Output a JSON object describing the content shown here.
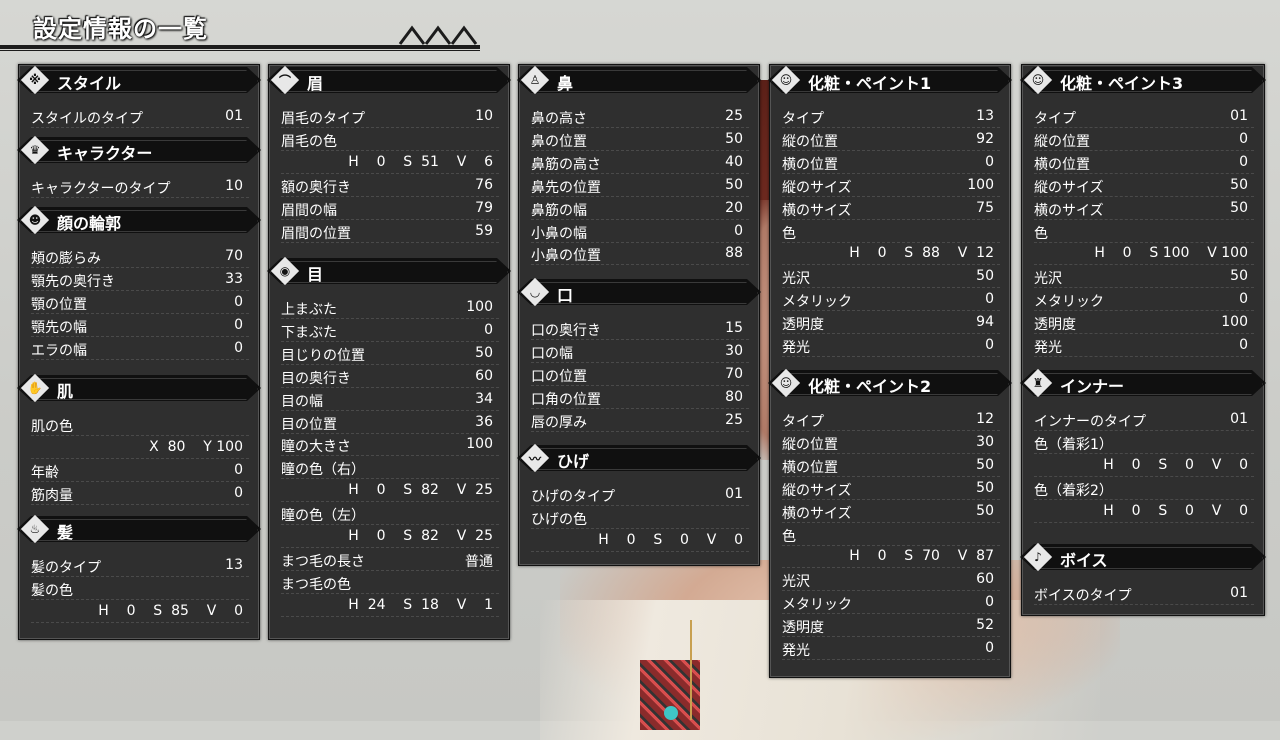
{
  "title": "設定情報の一覧",
  "columns": [
    {
      "sections": [
        {
          "head": "スタイル",
          "icon": "※",
          "rows": [
            {
              "k": "スタイルのタイプ",
              "v": "01"
            }
          ]
        },
        {
          "head": "キャラクター",
          "icon": "♛",
          "rows": [
            {
              "k": "キャラクターのタイプ",
              "v": "10"
            }
          ]
        },
        {
          "head": "顔の輪郭",
          "icon": "☻",
          "rows": [
            {
              "k": "頬の膨らみ",
              "v": "70"
            },
            {
              "k": "顎先の奥行き",
              "v": "33"
            },
            {
              "k": "顎の位置",
              "v": "0"
            },
            {
              "k": "顎先の幅",
              "v": "0"
            },
            {
              "k": "エラの幅",
              "v": "0"
            }
          ]
        },
        {
          "head": "肌",
          "icon": "✋",
          "rows": [
            {
              "k": "肌の色",
              "v": ""
            },
            {
              "k": "",
              "v": "X  80    Y 100"
            },
            {
              "k": "年齢",
              "v": "0"
            },
            {
              "k": "筋肉量",
              "v": "0"
            }
          ]
        },
        {
          "head": "髪",
          "icon": "♨",
          "rows": [
            {
              "k": "髪のタイプ",
              "v": "13"
            },
            {
              "k": "髪の色",
              "v": ""
            },
            {
              "k": "",
              "v": "H    0    S  85    V    0"
            }
          ]
        }
      ]
    },
    {
      "sections": [
        {
          "head": "眉",
          "icon": "⌒",
          "rows": [
            {
              "k": "眉毛のタイプ",
              "v": "10"
            },
            {
              "k": "眉毛の色",
              "v": ""
            },
            {
              "k": "",
              "v": "H    0    S  51    V    6"
            },
            {
              "k": "額の奥行き",
              "v": "76"
            },
            {
              "k": "眉間の幅",
              "v": "79"
            },
            {
              "k": "眉間の位置",
              "v": "59"
            }
          ]
        },
        {
          "head": "目",
          "icon": "◉",
          "rows": [
            {
              "k": "上まぶた",
              "v": "100"
            },
            {
              "k": "下まぶた",
              "v": "0"
            },
            {
              "k": "目じりの位置",
              "v": "50"
            },
            {
              "k": "目の奥行き",
              "v": "60"
            },
            {
              "k": "目の幅",
              "v": "34"
            },
            {
              "k": "目の位置",
              "v": "36"
            },
            {
              "k": "瞳の大きさ",
              "v": "100"
            },
            {
              "k": "瞳の色（右）",
              "v": ""
            },
            {
              "k": "",
              "v": "H    0    S  82    V  25"
            },
            {
              "k": "瞳の色（左）",
              "v": ""
            },
            {
              "k": "",
              "v": "H    0    S  82    V  25"
            },
            {
              "k": "まつ毛の長さ",
              "v": "普通"
            },
            {
              "k": "まつ毛の色",
              "v": ""
            },
            {
              "k": "",
              "v": "H  24    S  18    V    1"
            }
          ]
        }
      ]
    },
    {
      "sections": [
        {
          "head": "鼻",
          "icon": "♙",
          "rows": [
            {
              "k": "鼻の高さ",
              "v": "25"
            },
            {
              "k": "鼻の位置",
              "v": "50"
            },
            {
              "k": "鼻筋の高さ",
              "v": "40"
            },
            {
              "k": "鼻先の位置",
              "v": "50"
            },
            {
              "k": "鼻筋の幅",
              "v": "20"
            },
            {
              "k": "小鼻の幅",
              "v": "0"
            },
            {
              "k": "小鼻の位置",
              "v": "88"
            }
          ]
        },
        {
          "head": "口",
          "icon": "◡",
          "rows": [
            {
              "k": "口の奥行き",
              "v": "15"
            },
            {
              "k": "口の幅",
              "v": "30"
            },
            {
              "k": "口の位置",
              "v": "70"
            },
            {
              "k": "口角の位置",
              "v": "80"
            },
            {
              "k": "唇の厚み",
              "v": "25"
            }
          ]
        },
        {
          "head": "ひげ",
          "icon": "〰",
          "rows": [
            {
              "k": "ひげのタイプ",
              "v": "01"
            },
            {
              "k": "ひげの色",
              "v": ""
            },
            {
              "k": "",
              "v": "H    0    S    0    V    0"
            }
          ]
        }
      ]
    },
    {
      "sections": [
        {
          "head": "化粧・ペイント1",
          "icon": "☺",
          "rows": [
            {
              "k": "タイプ",
              "v": "13"
            },
            {
              "k": "縦の位置",
              "v": "92"
            },
            {
              "k": "横の位置",
              "v": "0"
            },
            {
              "k": "縦のサイズ",
              "v": "100"
            },
            {
              "k": "横のサイズ",
              "v": "75"
            },
            {
              "k": "色",
              "v": ""
            },
            {
              "k": "",
              "v": "H    0    S  88    V  12"
            },
            {
              "k": "光沢",
              "v": "50"
            },
            {
              "k": "メタリック",
              "v": "0"
            },
            {
              "k": "透明度",
              "v": "94"
            },
            {
              "k": "発光",
              "v": "0"
            }
          ]
        },
        {
          "head": "化粧・ペイント2",
          "icon": "☺",
          "rows": [
            {
              "k": "タイプ",
              "v": "12"
            },
            {
              "k": "縦の位置",
              "v": "30"
            },
            {
              "k": "横の位置",
              "v": "50"
            },
            {
              "k": "縦のサイズ",
              "v": "50"
            },
            {
              "k": "横のサイズ",
              "v": "50"
            },
            {
              "k": "色",
              "v": ""
            },
            {
              "k": "",
              "v": "H    0    S  70    V  87"
            },
            {
              "k": "光沢",
              "v": "60"
            },
            {
              "k": "メタリック",
              "v": "0"
            },
            {
              "k": "透明度",
              "v": "52"
            },
            {
              "k": "発光",
              "v": "0"
            }
          ]
        }
      ]
    },
    {
      "sections": [
        {
          "head": "化粧・ペイント3",
          "icon": "☺",
          "rows": [
            {
              "k": "タイプ",
              "v": "01"
            },
            {
              "k": "縦の位置",
              "v": "0"
            },
            {
              "k": "横の位置",
              "v": "0"
            },
            {
              "k": "縦のサイズ",
              "v": "50"
            },
            {
              "k": "横のサイズ",
              "v": "50"
            },
            {
              "k": "色",
              "v": ""
            },
            {
              "k": "",
              "v": "H    0    S 100    V 100"
            },
            {
              "k": "光沢",
              "v": "50"
            },
            {
              "k": "メタリック",
              "v": "0"
            },
            {
              "k": "透明度",
              "v": "100"
            },
            {
              "k": "発光",
              "v": "0"
            }
          ]
        },
        {
          "head": "インナー",
          "icon": "♜",
          "rows": [
            {
              "k": "インナーのタイプ",
              "v": "01"
            },
            {
              "k": "色（着彩1）",
              "v": ""
            },
            {
              "k": "",
              "v": "H    0    S    0    V    0"
            },
            {
              "k": "色（着彩2）",
              "v": ""
            },
            {
              "k": "",
              "v": "H    0    S    0    V    0"
            }
          ]
        },
        {
          "head": "ボイス",
          "icon": "♪",
          "rows": [
            {
              "k": "ボイスのタイプ",
              "v": "01"
            }
          ]
        }
      ]
    }
  ]
}
